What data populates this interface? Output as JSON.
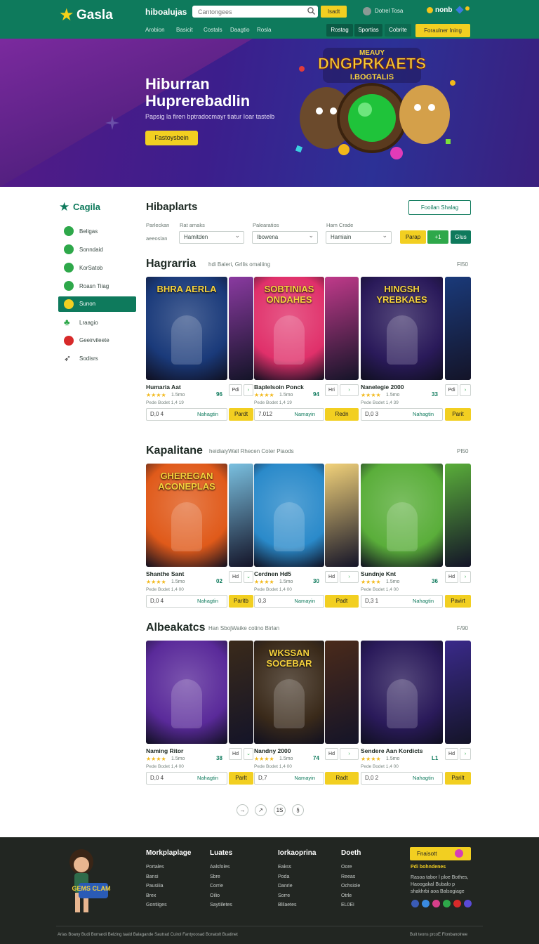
{
  "header": {
    "logo": "Gasla",
    "brand": "hiboalujas",
    "search_placeholder": "Cantongees",
    "search_button": "Isadt",
    "user": "Dotrel Tosa",
    "coins": "nonb",
    "nav": [
      "Arobion",
      "Basicit",
      "Costals",
      "Daagtio",
      "Rosla"
    ],
    "tabs": [
      "Rostag",
      "Sportias",
      "Cobrite"
    ],
    "cta": "Foraulner Ining"
  },
  "hero": {
    "title_line1": "Hiburran",
    "title_line2": "Huprerebadlin",
    "subtitle": "Papsig la firen bptradocmayr tiatur Ioar tastelb",
    "button": "Fastoysbein",
    "art_title_line1": "MEAUY",
    "art_title_line2": "DNGPRKAETS",
    "art_title_line3": "I.BOGTALIS"
  },
  "sidebar": {
    "title": "Cagila",
    "items": [
      {
        "label": "Beligas",
        "icon": "check-circle-icon",
        "color": "#2ea84a",
        "active": false
      },
      {
        "label": "Sonndaid",
        "icon": "check-circle-icon",
        "color": "#2ea84a",
        "active": false
      },
      {
        "label": "KorSatob",
        "icon": "check-circle-icon",
        "color": "#2ea84a",
        "active": false
      },
      {
        "label": "Roasn Tiiag",
        "icon": "check-circle-icon",
        "color": "#2ea84a",
        "active": false
      },
      {
        "label": "Sunon",
        "icon": "lightning-icon",
        "color": "#f2cf21",
        "active": true
      },
      {
        "label": "Lraagio",
        "icon": "clover-icon",
        "color": "#2ea84a",
        "active": false
      },
      {
        "label": "Geeirvileete",
        "icon": "red-circle-icon",
        "color": "#d72a2a",
        "active": false
      },
      {
        "label": "Sodisrs",
        "icon": "rocket-icon",
        "color": "#333333",
        "active": false
      }
    ]
  },
  "main": {
    "title": "Hibaplarts",
    "button": "Fooilan Shalag",
    "filters": [
      {
        "label": "Parleckan",
        "side_label": "aeeoslan",
        "value": "Hamitden"
      },
      {
        "label": "Palearatios",
        "value": "Ibowena"
      },
      {
        "label": "Ham Crade",
        "value": "Hamiain"
      }
    ],
    "pills": [
      "Parap",
      "+1",
      "Glus"
    ]
  },
  "sections": [
    {
      "title": "Hagrarria",
      "subtitle": "hdi Baleri, Grllis omaliing",
      "count": "FI50",
      "games": [
        {
          "cover_text": "BHRA AERLA",
          "title": "Humaria Aat",
          "rating": "1.5mo",
          "score": "96",
          "meta": "Pede Bodet 1,4 19",
          "price": "D,0 4",
          "price_link": "Nahagtin",
          "btn": "Pardt"
        },
        {
          "cover_text": "SOBTINIAS ONDAHES",
          "title": "Baplelsoin Ponck",
          "rating": "1.5mo",
          "score": "94",
          "meta": "Pede Bodet 1,4 19",
          "price": "7.012",
          "price_link": "Namayin",
          "btn": "Redn"
        },
        {
          "cover_text": "HINGSH YREBKAES",
          "title": "Nanelegie 2000",
          "rating": "1.5mo",
          "score": "33",
          "meta": "Pede Bodet 1,4 39",
          "price": "D,0 3",
          "price_link": "Nahagtin",
          "btn": "Parit"
        }
      ],
      "minis": [
        "Pdi",
        "Hri",
        "Pdi"
      ]
    },
    {
      "title": "Kapalitane",
      "subtitle": "heidiaiyWall Rhecen Coter Piaods",
      "count": "PI50",
      "games": [
        {
          "cover_text": "GHEREGAN ACONEPLAS",
          "title": "Shanthe Sant",
          "rating": "1.5mo",
          "score": "02",
          "meta": "Pede Bodet 1,4 00",
          "price": "D,0 4",
          "price_link": "Nahagtin",
          "btn": "Paritb"
        },
        {
          "cover_text": "",
          "title": "Cerdnen Hd5",
          "rating": "1.5mo",
          "score": "30",
          "meta": "Pede Bodet 1,4 00",
          "price": "0,3",
          "price_link": "Namayin",
          "btn": "Padt"
        },
        {
          "cover_text": "",
          "title": "Sundnje Knt",
          "rating": "1.5mo",
          "score": "36",
          "meta": "Pede Bodet 1,4 00",
          "price": "D,3 1",
          "price_link": "Nahagtin",
          "btn": "Pavirt"
        }
      ],
      "minis": [
        "Hd",
        "Hd",
        "Hd"
      ]
    },
    {
      "title": "Albeakatcs",
      "subtitle": "Han SbojWaike cotino Birlan",
      "count": "F/90",
      "games": [
        {
          "cover_text": "",
          "title": "Naming Ritor",
          "rating": "1.5mo",
          "score": "38",
          "meta": "Pede Bodet 1,4 00",
          "price": "D,0 4",
          "price_link": "Nahagtin",
          "btn": "Parlt"
        },
        {
          "cover_text": "WKSSAN SOCEBAR",
          "title": "Nandny 2000",
          "rating": "1.5mo",
          "score": "74",
          "meta": "Pede Bodet 1,4 00",
          "price": "D,7",
          "price_link": "Namayin",
          "btn": "Radt"
        },
        {
          "cover_text": "",
          "title": "Sendere Aan Kordicts",
          "rating": "1.5mo",
          "score": "L1",
          "meta": "Pede Bodet 1,4 00",
          "price": "D,0 2",
          "price_link": "Nahagtin",
          "btn": "Parilt"
        }
      ],
      "minis": [
        "Hd",
        "Hd",
        "Hd"
      ]
    }
  ],
  "pagination": [
    "→",
    "↗",
    "1S",
    "§"
  ],
  "footer": {
    "mascot_text": "GEMS CLAMS",
    "columns": [
      {
        "title": "Morkplaplage",
        "links": [
          "Portales",
          "Bansi",
          "Pausiiia",
          "Brex",
          "Gontiiges"
        ]
      },
      {
        "title": "Luates",
        "links": [
          "Aalsfoles",
          "Sbre",
          "Corrie",
          "Oilio",
          "Saytiiletes"
        ]
      },
      {
        "title": "Iorkaoprina",
        "links": [
          "Eakss",
          "Poda",
          "Danrie",
          "Sorre",
          "Blilaetes"
        ]
      },
      {
        "title": "Doeth",
        "links": [
          "Oore",
          "Reeas",
          "Ochsiole",
          "Otrle",
          "EL0Ei"
        ]
      }
    ],
    "subscribe_btn": "Fnaisott",
    "blurb_title": "Pdi bohndenes",
    "blurb": "Rasoa tabor l ploe Bothes, Haoogakal Bubalo p shakhrbi aoa Balsogiage",
    "legal": "Arias Boany Budi Bomardi Belzing taaid Balagande Sautrad Cuirol Fantyoosad Bonatolt Buatinet",
    "copyright": "Buit teons prcoE Flonbanolnee",
    "colors": {
      "brand": "#0e7a5c",
      "accent": "#f2cf21",
      "footer": "#222622"
    }
  }
}
